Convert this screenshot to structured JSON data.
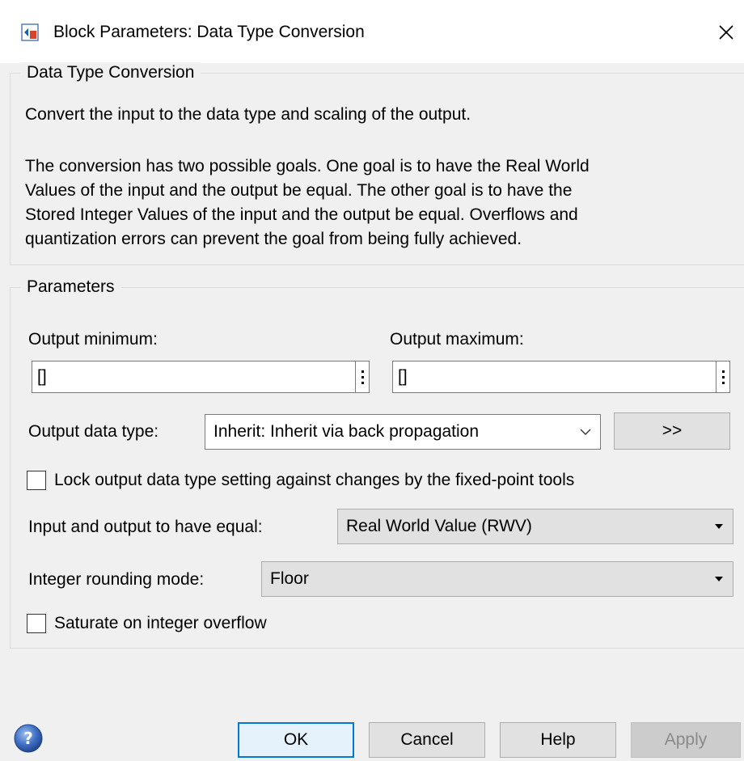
{
  "window": {
    "title": "Block Parameters: Data Type Conversion",
    "close_glyph": "✕"
  },
  "description": {
    "legend": "Data Type Conversion",
    "line1": "Convert the input to the data type and scaling of the output.",
    "para": [
      "The conversion has two possible goals. One goal is to have the Real World",
      "Values of the input and the output be equal.  The other goal is to have the",
      "Stored Integer Values of the input and the output be equal.  Overflows and",
      "quantization errors can prevent the goal from being fully achieved."
    ]
  },
  "parameters": {
    "legend": "Parameters",
    "output_min_label": "Output minimum:",
    "output_min_value": "[]",
    "output_max_label": "Output maximum:",
    "output_max_value": "[]",
    "output_dtype_label": "Output data type:",
    "output_dtype_value": "Inherit: Inherit via back propagation",
    "assistant_button": ">>",
    "lock_label": "Lock output data type setting against changes by the fixed-point tools",
    "lock_checked": false,
    "equal_label": "Input and output to have equal:",
    "equal_value": "Real World Value (RWV)",
    "rounding_label": "Integer rounding mode:",
    "rounding_value": "Floor",
    "saturate_label": "Saturate on integer overflow",
    "saturate_checked": false
  },
  "footer": {
    "ok": "OK",
    "cancel": "Cancel",
    "help": "Help",
    "apply": "Apply"
  },
  "icons": {
    "app": "simulink-block-icon",
    "help": "help-icon",
    "close": "close-icon"
  }
}
